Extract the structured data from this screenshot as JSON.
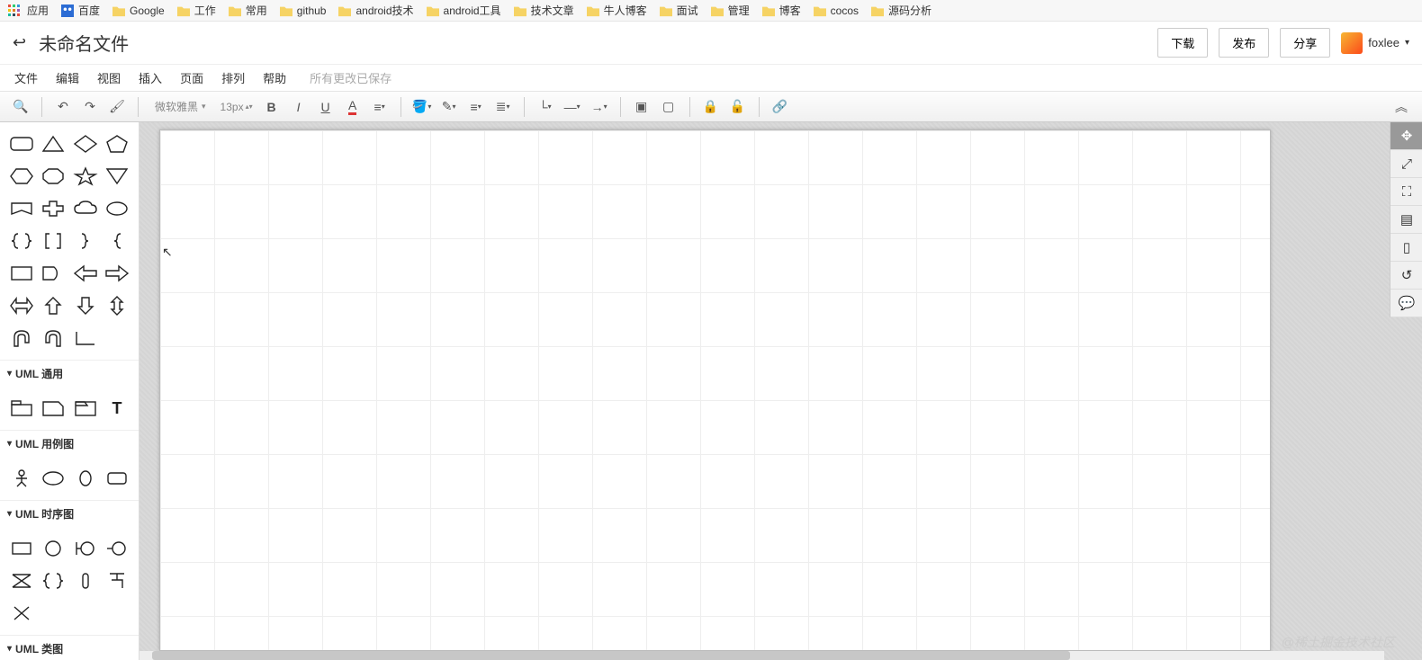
{
  "bookmarks": {
    "apps": "应用",
    "baidu": "百度",
    "items": [
      "Google",
      "工作",
      "常用",
      "github",
      "android技术",
      "android工具",
      "技术文章",
      "牛人博客",
      "面试",
      "管理",
      "博客",
      "cocos",
      "源码分析"
    ]
  },
  "header": {
    "title": "未命名文件",
    "download": "下载",
    "publish": "发布",
    "share": "分享",
    "username": "foxlee"
  },
  "menus": [
    "文件",
    "编辑",
    "视图",
    "插入",
    "页面",
    "排列",
    "帮助"
  ],
  "save_status": "所有更改已保存",
  "toolbar": {
    "font_family": "微软雅黑",
    "font_size": "13px"
  },
  "categories": {
    "uml_general": "UML 通用",
    "uml_usecase": "UML 用例图",
    "uml_sequence": "UML 时序图",
    "uml_class": "UML 类图"
  },
  "watermark": "@稀土掘金技术社区"
}
